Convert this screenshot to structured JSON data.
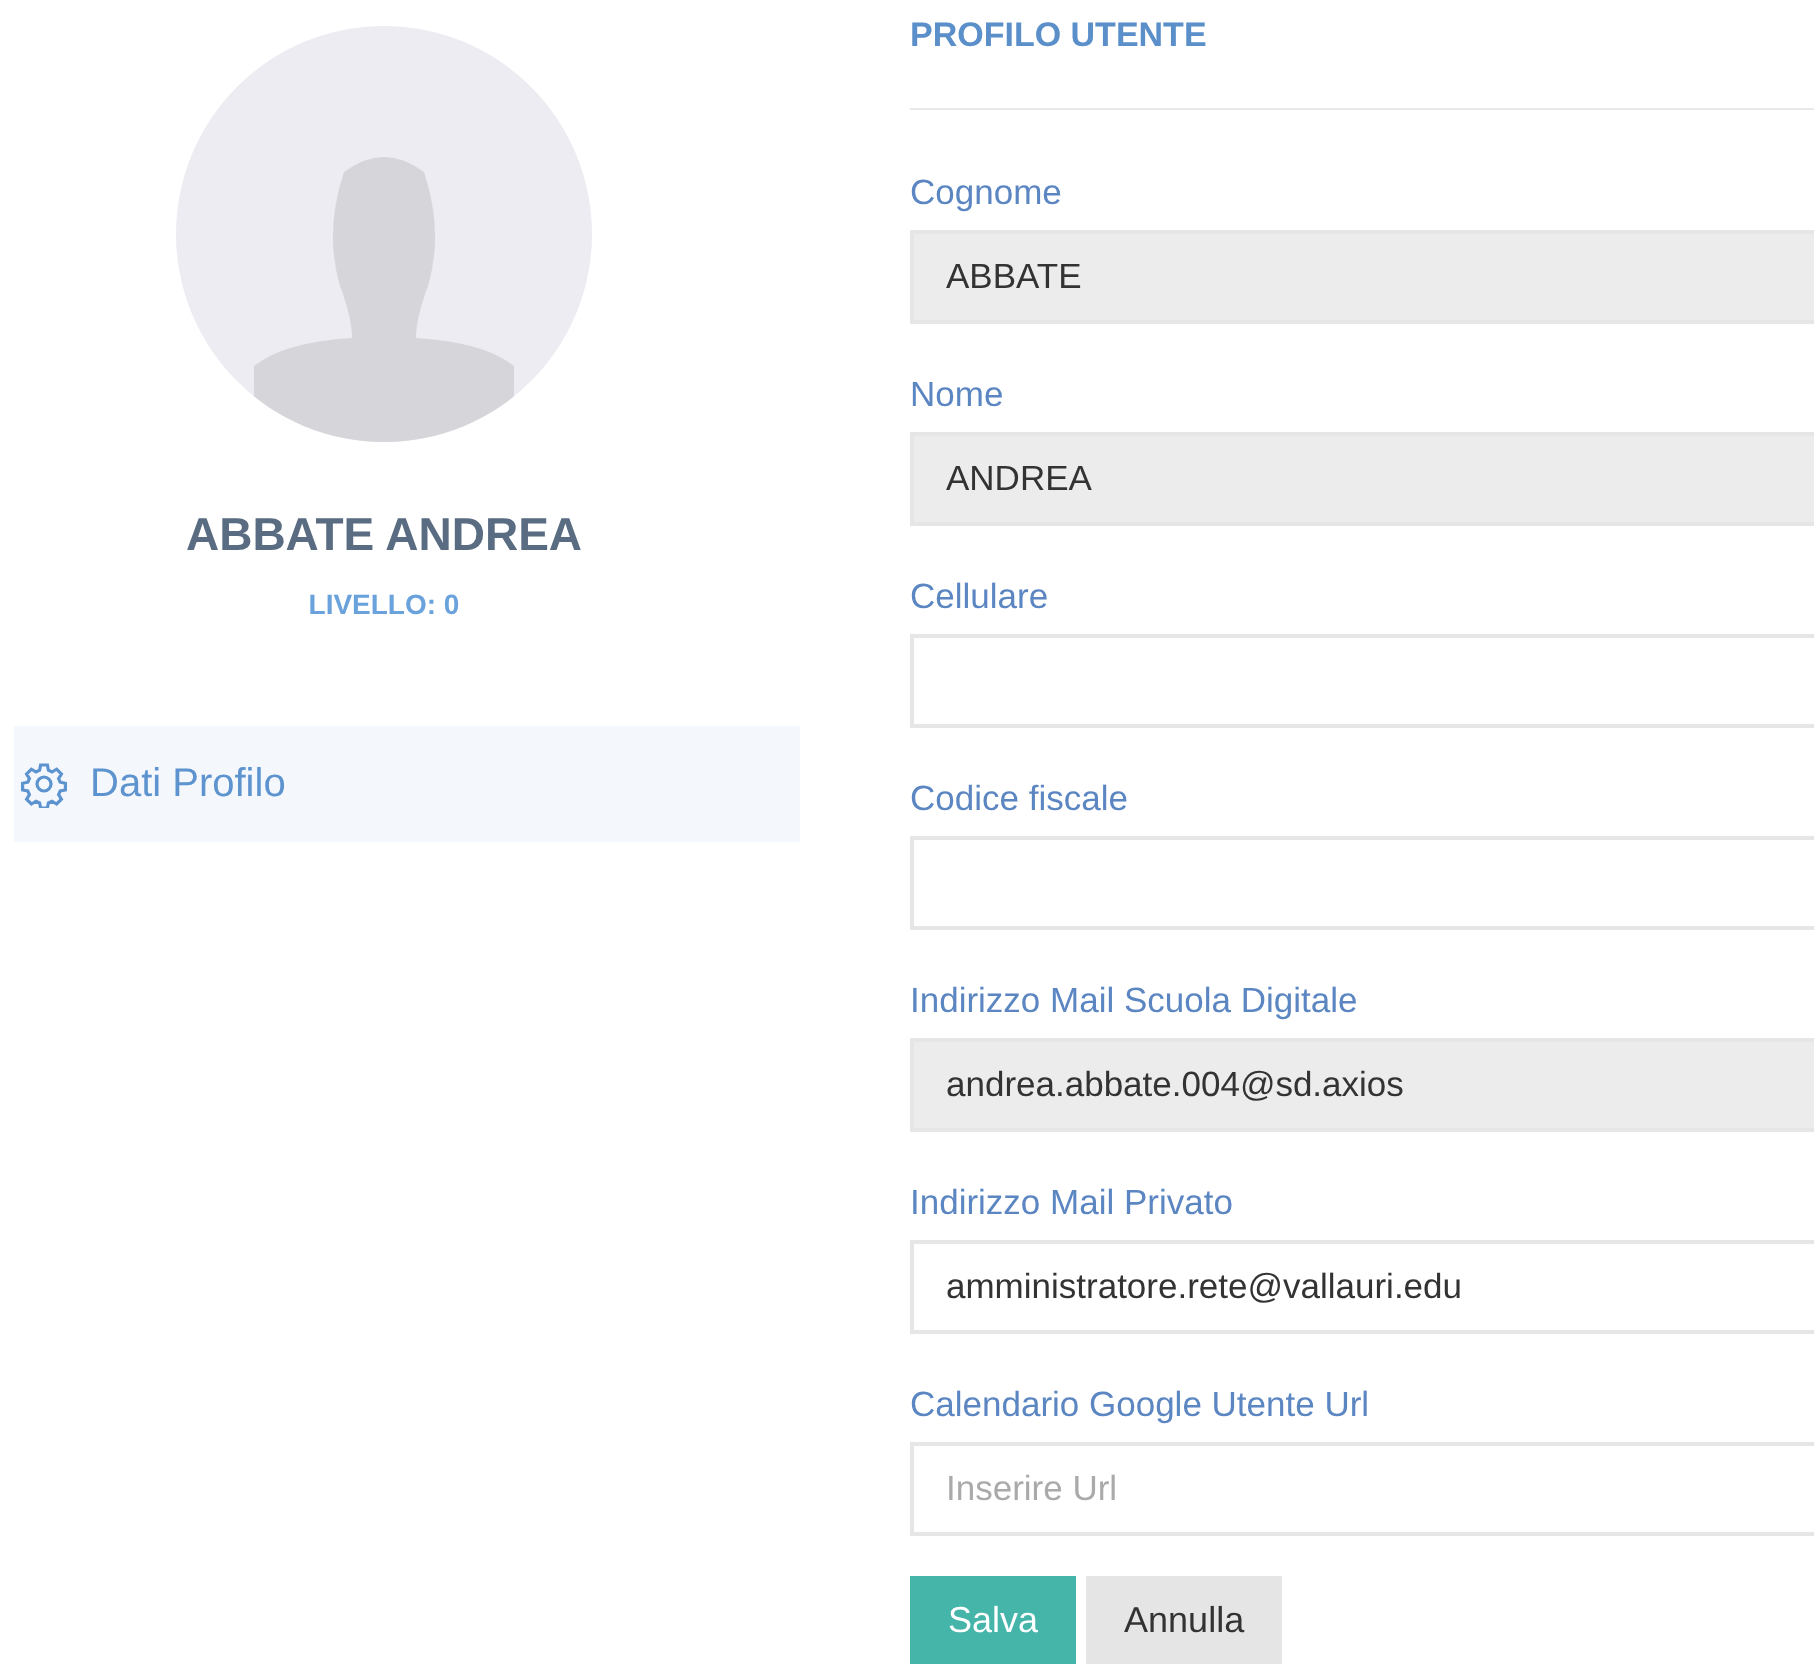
{
  "profile": {
    "name": "ABBATE ANDREA",
    "level_label": "LIVELLO: 0"
  },
  "sidebar": {
    "items": [
      {
        "label": "Dati Profilo",
        "selected": true
      }
    ]
  },
  "form": {
    "title": "PROFILO UTENTE",
    "fields": [
      {
        "label": "Cognome",
        "value": "ABBATE",
        "disabled": true
      },
      {
        "label": "Nome",
        "value": "ANDREA",
        "disabled": true
      },
      {
        "label": "Cellulare",
        "disabled": false
      },
      {
        "label": "Codice fiscale",
        "disabled": false
      },
      {
        "label": "Indirizzo Mail Scuola Digitale",
        "value": "andrea.abbate.004@sd.axios",
        "disabled": true
      },
      {
        "label": "Indirizzo Mail Privato",
        "value": "amministratore.rete@vallauri.edu",
        "disabled": false
      },
      {
        "label": "Calendario Google Utente Url",
        "placeholder": "Inserire Url",
        "disabled": false
      }
    ],
    "buttons": [
      {
        "label": "Salva",
        "kind": "primary"
      },
      {
        "label": "Annulla",
        "kind": "secondary"
      }
    ]
  }
}
